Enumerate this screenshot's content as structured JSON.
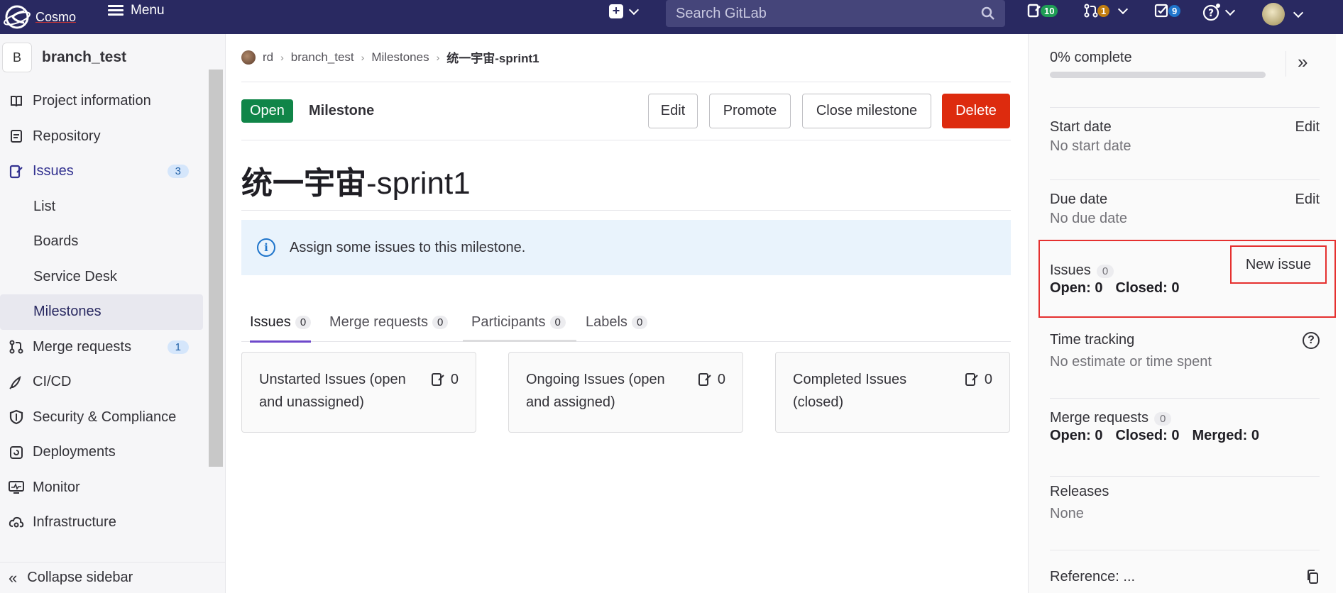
{
  "topbar": {
    "brand": "Cosmo",
    "menu_label": "Menu",
    "search_placeholder": "Search GitLab",
    "issues_count": "10",
    "merge_requests_count": "1",
    "todos_count": "9"
  },
  "sidebar": {
    "project_initial": "B",
    "project_name": "branch_test",
    "items": [
      {
        "label": "Project information",
        "icon": "book-icon"
      },
      {
        "label": "Repository",
        "icon": "doc-icon"
      },
      {
        "label": "Issues",
        "icon": "issues-icon",
        "badge": "3"
      },
      {
        "label": "List"
      },
      {
        "label": "Boards"
      },
      {
        "label": "Service Desk"
      },
      {
        "label": "Milestones"
      },
      {
        "label": "Merge requests",
        "icon": "merge-request-icon",
        "badge": "1"
      },
      {
        "label": "CI/CD",
        "icon": "rocket-icon"
      },
      {
        "label": "Security & Compliance",
        "icon": "shield-icon"
      },
      {
        "label": "Deployments",
        "icon": "deployments-icon"
      },
      {
        "label": "Monitor",
        "icon": "monitor-icon"
      },
      {
        "label": "Infrastructure",
        "icon": "cloud-icon"
      }
    ],
    "collapse_label": "Collapse sidebar"
  },
  "breadcrumb": {
    "items": [
      "rd",
      "branch_test",
      "Milestones",
      "统一宇宙-sprint1"
    ]
  },
  "milestone": {
    "status": "Open",
    "label": "Milestone",
    "title_cjk": "统一宇宙",
    "title_latin": "-sprint1",
    "buttons": {
      "edit": "Edit",
      "promote": "Promote",
      "close": "Close milestone",
      "delete": "Delete"
    },
    "alert": "Assign some issues to this milestone."
  },
  "tabs": [
    {
      "label": "Issues",
      "count": "0"
    },
    {
      "label": "Merge requests",
      "count": "0"
    },
    {
      "label": "Participants",
      "count": "0"
    },
    {
      "label": "Labels",
      "count": "0"
    }
  ],
  "cards": [
    {
      "text": "Unstarted Issues (open and unassigned)",
      "count": "0"
    },
    {
      "text": "Ongoing Issues (open and assigned)",
      "count": "0"
    },
    {
      "text": "Completed Issues (closed)",
      "count": "0"
    }
  ],
  "right_sidebar": {
    "progress_text": "0% complete",
    "progress_fraction": 0,
    "start_date_title": "Start date",
    "start_date_value": "No start date",
    "due_date_title": "Due date",
    "due_date_value": "No due date",
    "edit_label": "Edit",
    "issues_title": "Issues",
    "issues_count": "0",
    "new_issue": "New issue",
    "issues_open": "Open: 0",
    "issues_closed": "Closed: 0",
    "time_tracking_title": "Time tracking",
    "time_tracking_value": "No estimate or time spent",
    "mr_title": "Merge requests",
    "mr_count": "0",
    "mr_open": "Open: 0",
    "mr_closed": "Closed: 0",
    "mr_merged": "Merged: 0",
    "releases_title": "Releases",
    "releases_value": "None",
    "reference": "Reference: ..."
  },
  "colors": {
    "topbar": "#292961",
    "open_badge": "#108548",
    "delete_button": "#dd2b0e",
    "alert_bg": "#e9f3fc",
    "highlight": "#e5302f"
  }
}
